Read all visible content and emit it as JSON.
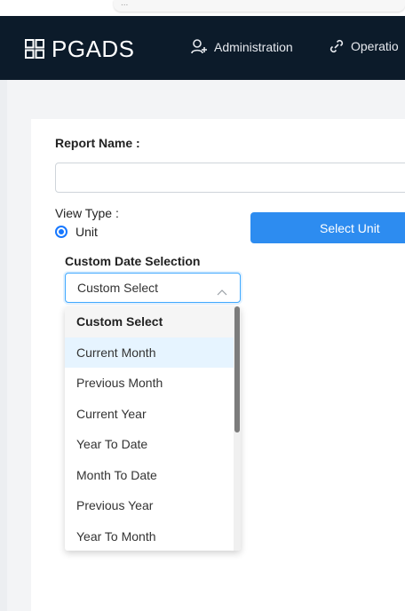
{
  "top_strip_text": "...",
  "brand": {
    "name": "PGADS",
    "icon": "grid-icon"
  },
  "nav": {
    "administration": {
      "label": "Administration",
      "icon": "user-plus-icon"
    },
    "operations": {
      "label": "Operatio",
      "icon": "link-icon"
    }
  },
  "form": {
    "report_name_label": "Report Name :",
    "report_name_value": "",
    "view_type_label": "View Type :",
    "view_type_option": "Unit",
    "select_unit_button": "Select Unit",
    "custom_date_label": "Custom Date Selection",
    "custom_select_value": "Custom Select"
  },
  "dropdown": {
    "options": [
      "Custom Select",
      "Current Month",
      "Previous Month",
      "Current Year",
      "Year To Date",
      "Month To Date",
      "Previous Year",
      "Year To Month"
    ],
    "selected_index": 0,
    "hover_index": 1
  },
  "colors": {
    "navbar": "#0c1b2a",
    "accent": "#2d8cf0",
    "hover": "#e6f4ff"
  }
}
